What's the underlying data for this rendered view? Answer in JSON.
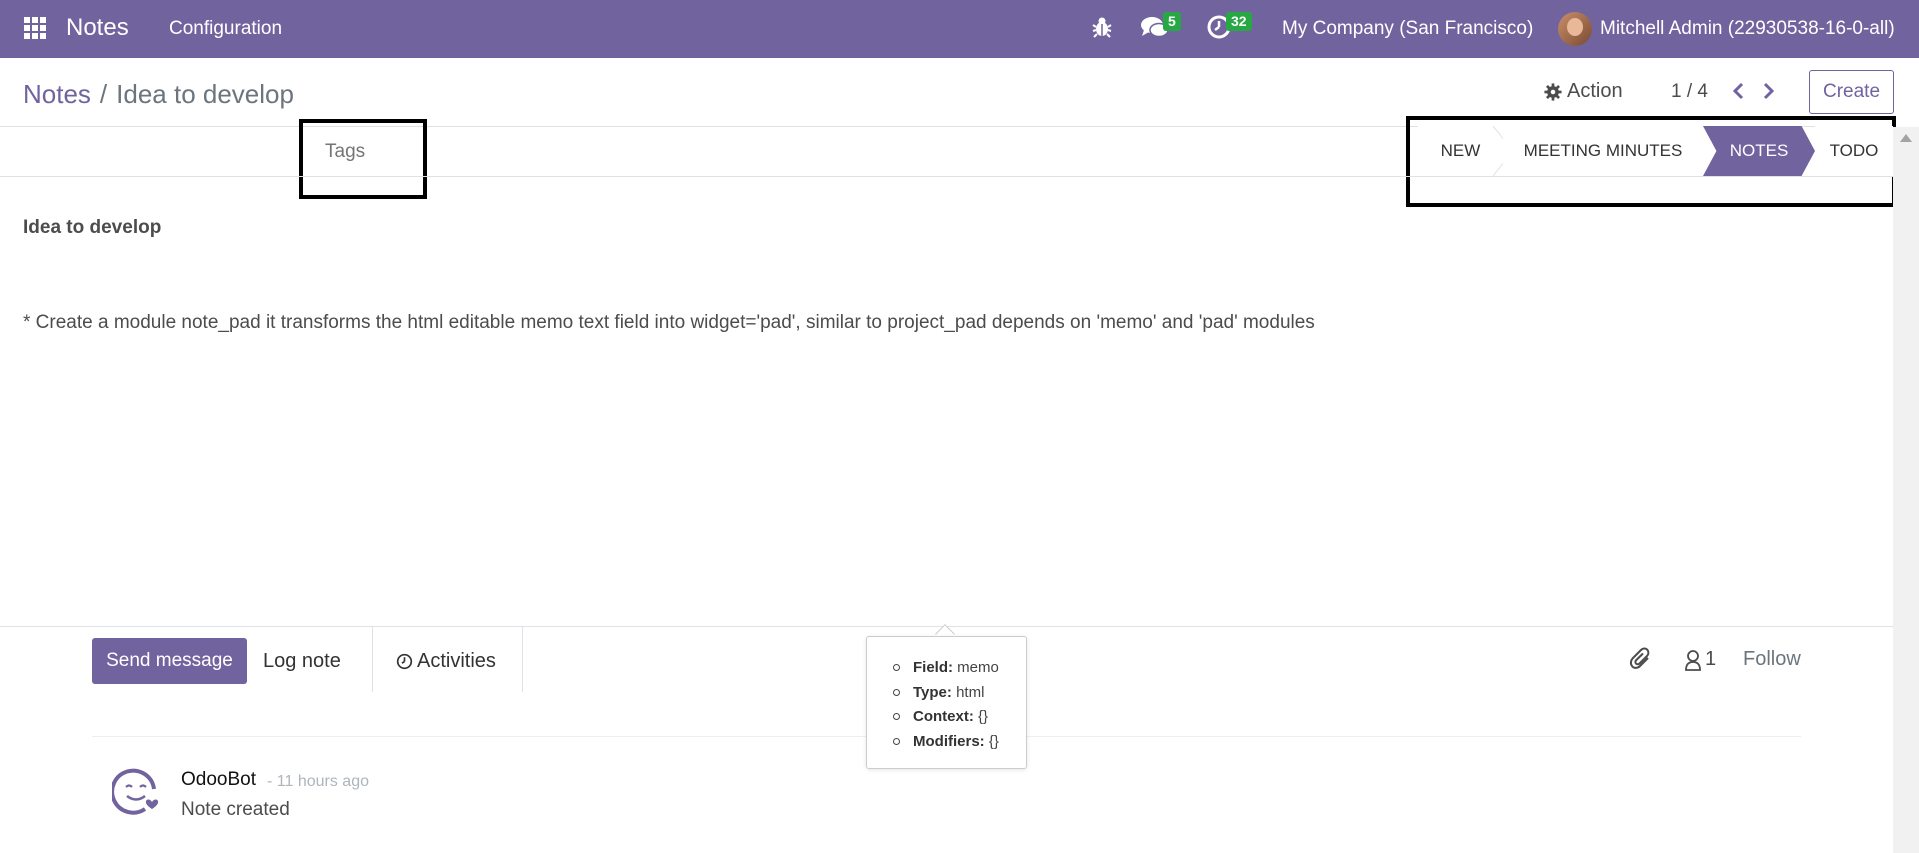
{
  "navbar": {
    "brand": "Notes",
    "menu_configuration": "Configuration",
    "messages_count": "5",
    "activities_count": "32",
    "company": "My Company (San Francisco)",
    "user": "Mitchell Admin (22930538-16-0-all)"
  },
  "control_panel": {
    "breadcrumb_parent": "Notes",
    "breadcrumb_separator": "/",
    "breadcrumb_current": "Idea to develop",
    "action_label": "Action",
    "pager": "1 / 4",
    "create_label": "Create"
  },
  "form": {
    "tags_placeholder": "Tags",
    "stages": [
      "NEW",
      "MEETING MINUTES",
      "NOTES",
      "TODO"
    ],
    "active_stage": "NOTES",
    "memo_title": "Idea to develop",
    "memo_body": "* Create a module note_pad it transforms the html editable memo text field into widget='pad', similar to project_pad depends on 'memo' and 'pad' modules"
  },
  "chatter": {
    "send_message": "Send message",
    "log_note": "Log note",
    "activities": "Activities",
    "followers_count": "1",
    "follow": "Follow",
    "message": {
      "author": "OdooBot",
      "date": "- 11 hours ago",
      "body": "Note created"
    }
  },
  "tooltip": {
    "field_label": "Field:",
    "field_value": "memo",
    "type_label": "Type:",
    "type_value": "html",
    "context_label": "Context:",
    "context_value": "{}",
    "modifiers_label": "Modifiers:",
    "modifiers_value": "{}"
  },
  "colors": {
    "brand": "#71639e",
    "badge": "#28a745"
  }
}
